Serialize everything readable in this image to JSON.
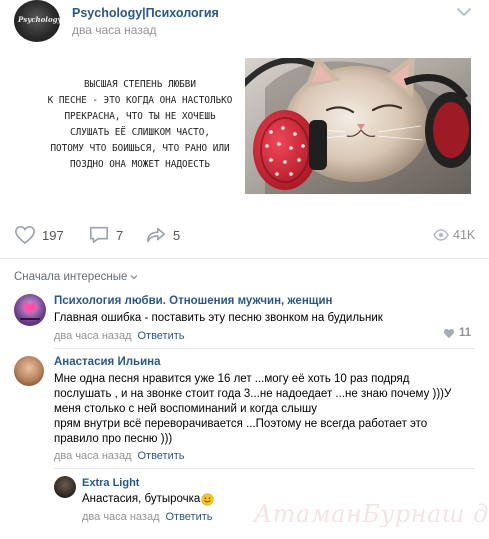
{
  "post": {
    "author": "Psychology|Психология",
    "avatar_text": "Psychology",
    "time": "два часа назад",
    "quote_text": "Высшая степень любви\nк песне - это когда она настолько\nпрекрасна, что ты не хочешь\nслушать её слишком часто,\nпотому что боишься, что рано или\nпоздно она может надоесть",
    "likes": "197",
    "comments": "7",
    "shares": "5",
    "views": "41K"
  },
  "sort_label": "Сначала интересные",
  "comments": [
    {
      "author": "Психология любви. Отношения мужчин, женщин",
      "text": "Главная ошибка - поставить эту песню звонком на будильник",
      "time": "два часа назад",
      "reply_label": "Ответить",
      "likes": "11"
    },
    {
      "author": "Анастасия Ильина",
      "text": "Мне одна песня нравится уже 16 лет ...могу её хоть 10 раз подряд\nпослушать , и на звонке стоит года 3...не надоедает ...не знаю почему )))У\nменя столько с ней воспоминаний и когда слышу\nпрям внутри всё переворачивается ...Поэтому не всегда работает это\nправило про песню )))",
      "time": "два часа назад",
      "reply_label": "Ответить"
    },
    {
      "author": "Extra Light",
      "text": "Анастасия, бутырочка",
      "time": "два часа назад",
      "reply_label": "Ответить"
    }
  ],
  "watermark": "АтаманБурнаш для ЯП",
  "colors": {
    "link": "#2a5885",
    "meta": "#939393",
    "divider": "#e7e8ec",
    "headphone_red": "#d9293b"
  },
  "icons": [
    "chevron-down-icon",
    "heart-icon",
    "comment-icon",
    "share-icon",
    "eye-icon",
    "small-heart-icon",
    "smile-emoji-icon"
  ]
}
